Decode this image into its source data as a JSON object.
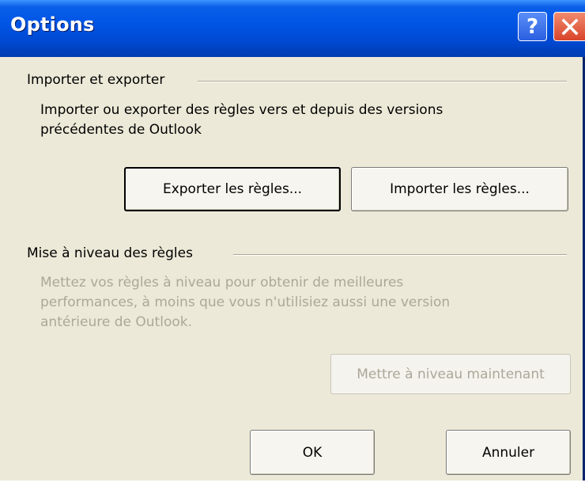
{
  "window": {
    "title": "Options",
    "help_glyph": "?",
    "icons": {
      "help": "help-question-icon",
      "close": "close-x-icon"
    },
    "colors": {
      "titlebar": "#0055e5",
      "close": "#d9442a",
      "face": "#ece9d8"
    }
  },
  "import_export": {
    "heading": "Importer et exporter",
    "description_line1": "Importer ou exporter des règles vers et depuis des versions",
    "description_line2": "précédentes de Outlook",
    "export_button": "Exporter les règles...",
    "import_button": "Importer les règles..."
  },
  "upgrade": {
    "heading": "Mise à niveau des règles",
    "description_line1": "Mettez vos règles à niveau pour obtenir de meilleures",
    "description_line2": "performances, à moins que vous n'utilisiez aussi une version",
    "description_line3": "antérieure de Outlook.",
    "upgrade_button": "Mettre à niveau maintenant"
  },
  "footer": {
    "ok_button": "OK",
    "cancel_button": "Annuler"
  }
}
